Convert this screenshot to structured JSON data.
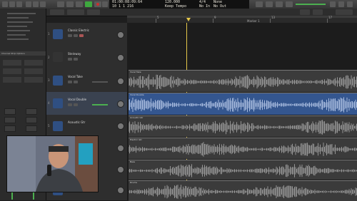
{
  "control_bar": {
    "time_position": "01:00:08:09:64",
    "bar_position": "10 1 1 216",
    "tempo": "120.000",
    "tempo_label": "Keep Tempo",
    "signature": "4/4",
    "signature_label": "No In",
    "key": "None",
    "key_label": "No Out"
  },
  "inspector": {
    "header": "Channel Strip Options"
  },
  "ruler": {
    "labels": [
      "5",
      "9",
      "13",
      "17"
    ],
    "marker": "Marker 1"
  },
  "tracks": [
    {
      "number": "1",
      "name": "Classic Electric",
      "icon": "keyboard-icon",
      "type": "instrument"
    },
    {
      "number": "2",
      "name": "Steinway",
      "icon": "piano-icon",
      "type": "instrument"
    },
    {
      "number": "3",
      "name": "Vocal Take",
      "icon": "waveform-icon",
      "type": "audio"
    },
    {
      "number": "4",
      "name": "Vocal Double",
      "icon": "waveform-icon",
      "type": "audio",
      "selected": true
    },
    {
      "number": "5",
      "name": "Acoustic Gtr",
      "icon": "waveform-icon",
      "type": "audio"
    },
    {
      "number": "6",
      "name": "Electric Gtr",
      "icon": "waveform-icon",
      "type": "audio"
    },
    {
      "number": "7",
      "name": "Bass",
      "icon": "waveform-icon",
      "type": "audio"
    },
    {
      "number": "8",
      "name": "Drums",
      "icon": "waveform-icon",
      "type": "audio"
    }
  ],
  "colors": {
    "region": "#3b3b3b",
    "region_selected": "#34568f",
    "waveform": "#bdbdbd",
    "waveform_selected": "#d8e6ff",
    "play": "#3ea83e",
    "record": "#c83030"
  }
}
